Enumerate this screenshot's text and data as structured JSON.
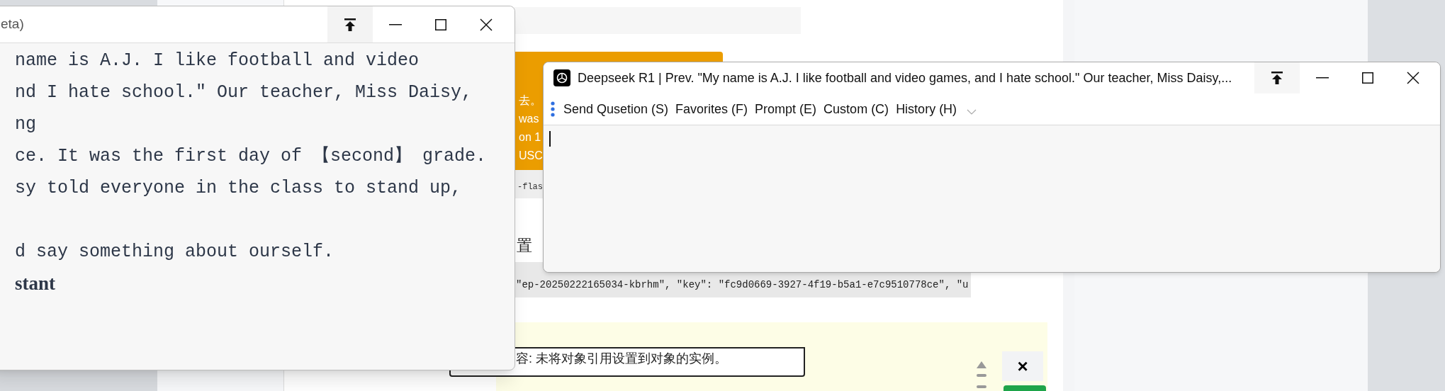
{
  "background": {
    "snippets": [
      {
        "kind": "banner",
        "text": "去。"
      },
      {
        "kind": "banner",
        "text": "was"
      },
      {
        "kind": "banner",
        "text": "on 1"
      },
      {
        "kind": "banner",
        "text": "USC"
      },
      {
        "kind": "code",
        "text": "-flas"
      },
      {
        "kind": "label",
        "text": "置"
      },
      {
        "kind": "code",
        "text": "\"ep-20250222165034-kbrhm\", \"key\": \"fc9d0669-3927-4f19-b5a1-e7c9510778ce\", \"u"
      },
      {
        "kind": "error",
        "text": "容: 未将对象引用设置到对象的实例。"
      }
    ],
    "close_label": "×"
  },
  "left_window": {
    "title": "eta)",
    "lines": [
      {
        "kind": "mono",
        "text": "name is A.J. I like football and video"
      },
      {
        "kind": "mono",
        "text": "nd I hate school.\" Our teacher, Miss Daisy,"
      },
      {
        "kind": "mono",
        "text": "ng"
      },
      {
        "kind": "mono",
        "text": "ce. It was the first day of 【second】 grade."
      },
      {
        "kind": "mono",
        "text": "sy told everyone in the class to stand up,"
      },
      {
        "kind": "blank"
      },
      {
        "kind": "mono",
        "text": "d say something about ourself."
      },
      {
        "kind": "heading",
        "text": "stant"
      }
    ]
  },
  "right_window": {
    "title": "Deepseek R1 | Prev. \"My name is A.J. I like football and video games, and I hate school.\" Our teacher, Miss Daisy,...",
    "menu": [
      "Send Qusetion (S)",
      "Favorites (F)",
      "Prompt (E)",
      "Custom (C)",
      "History (H)"
    ]
  }
}
